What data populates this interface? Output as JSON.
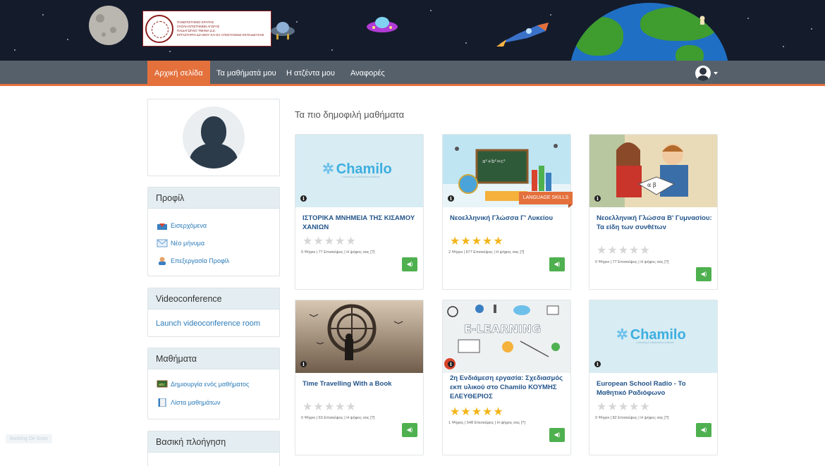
{
  "header": {
    "logo_text_lines": [
      "ΠΑΝΕΠΙΣΤΗΜΙΟ ΚΡΗΤΗΣ",
      "ΣΧΟΛΗ ΕΠΙΣΤΗΜΩΝ ΑΓΩΓΗΣ",
      "ΠΑΙΔΑΓΩΓΙΚΟ ΤΜΗΜΑ Δ.Ε.",
      "ΕΡΓΑΣΤΗΡΙΟ ΔΙΑ ΒΙΟΥ ΚΑΙ ΕΞ ΑΠΟΣΤΑΣΕΩΣ ΕΚΠΑΙΔΕΥΣΗΣ"
    ]
  },
  "nav": {
    "items": [
      {
        "label": "Αρχική σελίδα",
        "active": true
      },
      {
        "label": "Τα μαθήματά μου",
        "active": false
      },
      {
        "label": "Η ατζέντα μου",
        "active": false
      },
      {
        "label": "Αναφορές",
        "active": false
      }
    ],
    "user_icon": "user-circle-icon"
  },
  "sidebar": {
    "profile": {
      "title": "Προφίλ",
      "links": [
        {
          "label": "Εισερχόμενα",
          "icon": "inbox-icon"
        },
        {
          "label": "Νέο μήνυμα",
          "icon": "envelope-icon"
        },
        {
          "label": "Επεξεργασία Προφίλ",
          "icon": "edit-profile-icon"
        }
      ]
    },
    "videoconference": {
      "title": "Videoconference",
      "link": "Launch videoconference room"
    },
    "courses": {
      "title": "Μαθήματα",
      "links": [
        {
          "label": "Δημιουργία ενός μαθήματος",
          "icon": "create-course-icon"
        },
        {
          "label": "Λίστα μαθημάτων",
          "icon": "course-list-icon"
        }
      ]
    },
    "basic_nav": {
      "title": "Βασική πλοήγηση"
    },
    "faded_tag": "Backing De Scep"
  },
  "main": {
    "section_title": "Τα πιο δημοφιλή μαθήματα",
    "cards": [
      {
        "title": "ΙΣΤΟΡΙΚΑ ΜΝΗΜΕΙΑ ΤΗΣ ΚΙΣΑΜΟΥ ΧΑΝΙΩΝ",
        "rating": 0,
        "meta": "0 Ψήφοι | 77 Επισκέψεις | Η ψήφος σας [?]",
        "thumb": "chamilo",
        "ribbon": ""
      },
      {
        "title": "Νεοελληνική Γλώσσα Γ' Λυκείου",
        "rating": 5,
        "meta": "2 Ψήφοι | 677 Επισκέψεις | Η ψήφος σας [?]",
        "thumb": "classroom",
        "ribbon": "LANGUAGE SKILLS"
      },
      {
        "title": "Νεοελληνική Γλώσσα Β' Γυμνασίου: Τα είδη των συνθέτων",
        "rating": 0,
        "meta": "0 Ψήφοι | 77 Επισκέψεις | Η ψήφος σας [?]",
        "thumb": "children",
        "ribbon": ""
      },
      {
        "title": "Time Travelling With a Book",
        "rating": 0,
        "meta": "0 Ψήφοι | 63 Επισκέψεις | Η ψήφος σας [?]",
        "thumb": "clock",
        "ribbon": ""
      },
      {
        "title": "2η Ενδιάμεση εργασία: Σχεδιασμός εκπ υλικού στο Chamilo ΚΟΥΜΗΣ ΕΛΕΥΘΕΡΙΟΣ",
        "rating": 5,
        "meta": "1 Ψήφος | 548 Επισκέψεις | Η ψήφος σας [?]",
        "thumb": "elearning",
        "ribbon": ""
      },
      {
        "title": "European School Radio - Το Μαθητικό Ραδιόφωνο",
        "rating": 0,
        "meta": "0 Ψήφοι | 82 Επισκέψεις | Η ψήφος σας [?]",
        "thumb": "chamilo",
        "ribbon": ""
      }
    ],
    "chamilo_logo": "Chamilo",
    "chamilo_tagline": "e-learning & collaboration software",
    "elearning_label": "E-LEARNING"
  },
  "colors": {
    "accent": "#e4703c",
    "navbar": "#55606b",
    "link": "#2b7bb9",
    "star": "#f3b51b",
    "play_button": "#4fb04f"
  }
}
